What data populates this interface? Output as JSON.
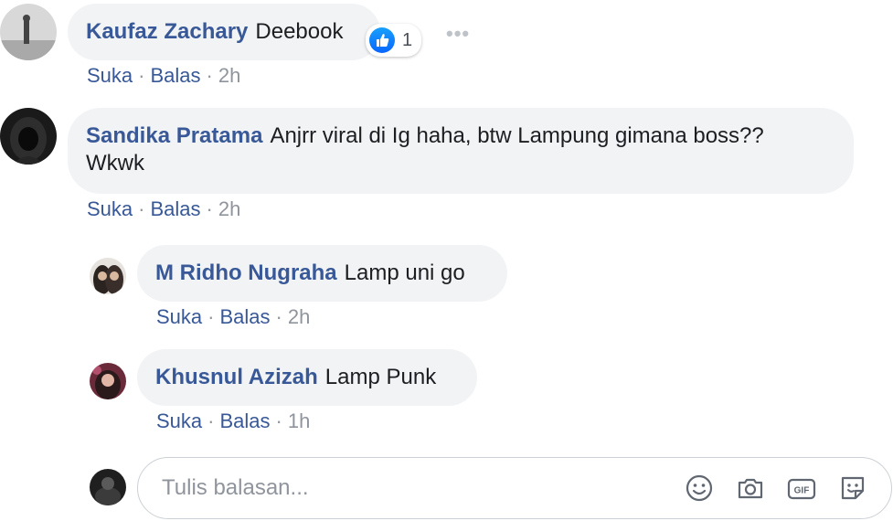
{
  "comments": [
    {
      "author": "Kaufaz Zachary",
      "text": "Deebook",
      "actions": {
        "like": "Suka",
        "reply": "Balas",
        "separator": "·",
        "time": "2h"
      },
      "reaction": {
        "icon": "like-icon",
        "count": "1"
      },
      "more": "•••"
    },
    {
      "author": "Sandika Pratama",
      "text_line1": "Anjrr viral di Ig haha, btw Lampung gimana boss??",
      "text_line2": "Wkwk",
      "actions": {
        "like": "Suka",
        "reply": "Balas",
        "separator": "·",
        "time": "2h"
      }
    }
  ],
  "replies": [
    {
      "author": "M Ridho Nugraha",
      "text": "Lamp uni go",
      "actions": {
        "like": "Suka",
        "reply": "Balas",
        "separator": "·",
        "time": "2h"
      }
    },
    {
      "author": "Khusnul Azizah",
      "text": "Lamp Punk",
      "actions": {
        "like": "Suka",
        "reply": "Balas",
        "separator": "·",
        "time": "1h"
      }
    }
  ],
  "composer": {
    "placeholder": "Tulis balasan...",
    "tools": [
      "emoji-icon",
      "camera-icon",
      "gif-icon",
      "sticker-icon"
    ],
    "gif_label": "GIF"
  },
  "colors": {
    "name": "#385898",
    "bubble": "#f2f3f5",
    "meta": "#90949c",
    "like": "#0866ff"
  }
}
